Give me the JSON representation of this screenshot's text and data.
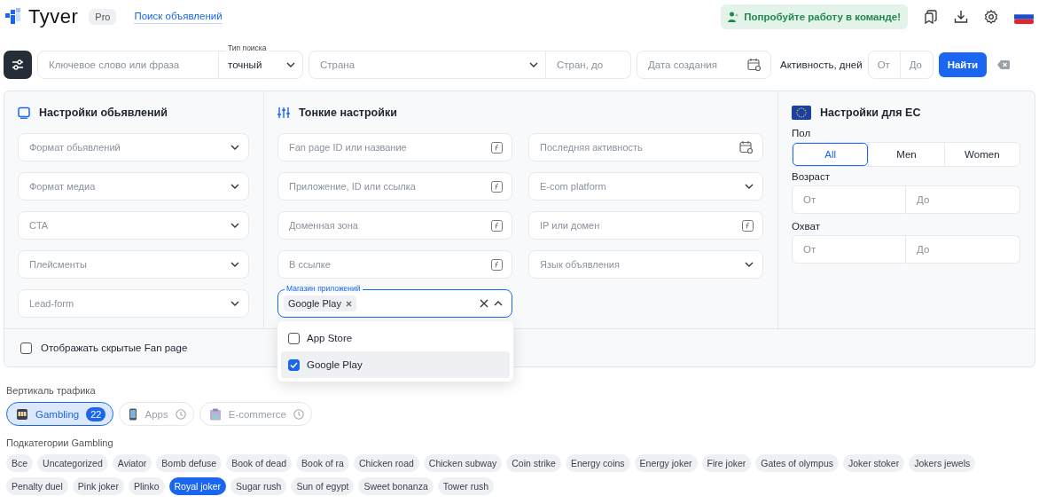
{
  "header": {
    "logo": {
      "name": "Tyver",
      "badge": "Pro"
    },
    "nav_link": "Поиск объявлений",
    "team_button": "Попробуйте работу в команде!"
  },
  "search_bar": {
    "keyword": {
      "placeholder": "Ключевое слово или фраза"
    },
    "search_type": {
      "label": "Тип поиска",
      "value": "точный"
    },
    "country": {
      "placeholder": "Страна"
    },
    "country_to": {
      "placeholder": "Стран, до"
    },
    "created": {
      "placeholder": "Дата создания"
    },
    "activity": {
      "label": "Активность, дней",
      "from": {
        "placeholder": "От"
      },
      "to": {
        "placeholder": "До"
      }
    },
    "find_button": "Найти"
  },
  "ad_settings": {
    "title": "Настройки обьявлений",
    "fields": [
      {
        "placeholder": "Формат обьявлений",
        "kind": "select"
      },
      {
        "placeholder": "Формат медиа",
        "kind": "select"
      },
      {
        "placeholder": "CTA",
        "kind": "select"
      },
      {
        "placeholder": "Плейсменты",
        "kind": "select"
      },
      {
        "placeholder": "Lead-form",
        "kind": "select"
      }
    ]
  },
  "fine_settings": {
    "title": "Тонкие настройки",
    "fields": [
      {
        "placeholder": "Fan page ID или название",
        "kind": "text"
      },
      {
        "placeholder": "Последняя активность",
        "kind": "date"
      },
      {
        "placeholder": "Приложение, ID или ссылка",
        "kind": "text"
      },
      {
        "placeholder": "E-com platform",
        "kind": "select"
      },
      {
        "placeholder": "Доменная зона",
        "kind": "text"
      },
      {
        "placeholder": "IP или домен",
        "kind": "text"
      },
      {
        "placeholder": "В ссылке",
        "kind": "text"
      },
      {
        "placeholder": "Язык объявления",
        "kind": "select"
      }
    ],
    "app_store": {
      "label": "Магазин приложений",
      "chips": [
        "Google Play"
      ],
      "expanded": true,
      "options": [
        {
          "label": "App Store",
          "checked": false
        },
        {
          "label": "Google Play",
          "checked": true
        }
      ]
    }
  },
  "eu_settings": {
    "title": "Настройки для ЕС",
    "gender": {
      "label": "Пол",
      "options": [
        {
          "label": "All",
          "selected": true
        },
        {
          "label": "Men",
          "selected": false
        },
        {
          "label": "Women",
          "selected": false
        }
      ]
    },
    "age": {
      "label": "Возраст",
      "from": {
        "placeholder": "От"
      },
      "to": {
        "placeholder": "До"
      }
    },
    "reach": {
      "label": "Охват",
      "from": {
        "placeholder": "От"
      },
      "to": {
        "placeholder": "До"
      }
    }
  },
  "hidden_fan_page": {
    "label": "Отображать скрытые Fan page",
    "checked": false
  },
  "verticals": {
    "label": "Вертикаль трафика",
    "items": [
      {
        "label": "Gambling",
        "kind": "gambling",
        "selected": true,
        "count": "22"
      },
      {
        "label": "Apps",
        "kind": "apps",
        "selected": false,
        "soon": true
      },
      {
        "label": "E-commerce",
        "kind": "ecommerce",
        "selected": false,
        "soon": true
      }
    ]
  },
  "subcategories": {
    "label": "Подкатегории Gambling",
    "tags": [
      {
        "label": "Все",
        "selected": false
      },
      {
        "label": "Uncategorized",
        "selected": false
      },
      {
        "label": "Aviator",
        "selected": false
      },
      {
        "label": "Bomb defuse",
        "selected": false
      },
      {
        "label": "Book of dead",
        "selected": false
      },
      {
        "label": "Book of ra",
        "selected": false
      },
      {
        "label": "Chicken road",
        "selected": false
      },
      {
        "label": "Chicken subway",
        "selected": false
      },
      {
        "label": "Coin strike",
        "selected": false
      },
      {
        "label": "Energy coins",
        "selected": false
      },
      {
        "label": "Energy joker",
        "selected": false
      },
      {
        "label": "Fire joker",
        "selected": false
      },
      {
        "label": "Gates of olympus",
        "selected": false
      },
      {
        "label": "Joker stoker",
        "selected": false
      },
      {
        "label": "Jokers jewels",
        "selected": false
      },
      {
        "label": "Penalty duel",
        "selected": false
      },
      {
        "label": "Pink joker",
        "selected": false
      },
      {
        "label": "Plinko",
        "selected": false
      },
      {
        "label": "Royal joker",
        "selected": true
      },
      {
        "label": "Sugar rush",
        "selected": false
      },
      {
        "label": "Sun of egypt",
        "selected": false
      },
      {
        "label": "Sweet bonanza",
        "selected": false
      },
      {
        "label": "Tower rush",
        "selected": false
      }
    ]
  }
}
